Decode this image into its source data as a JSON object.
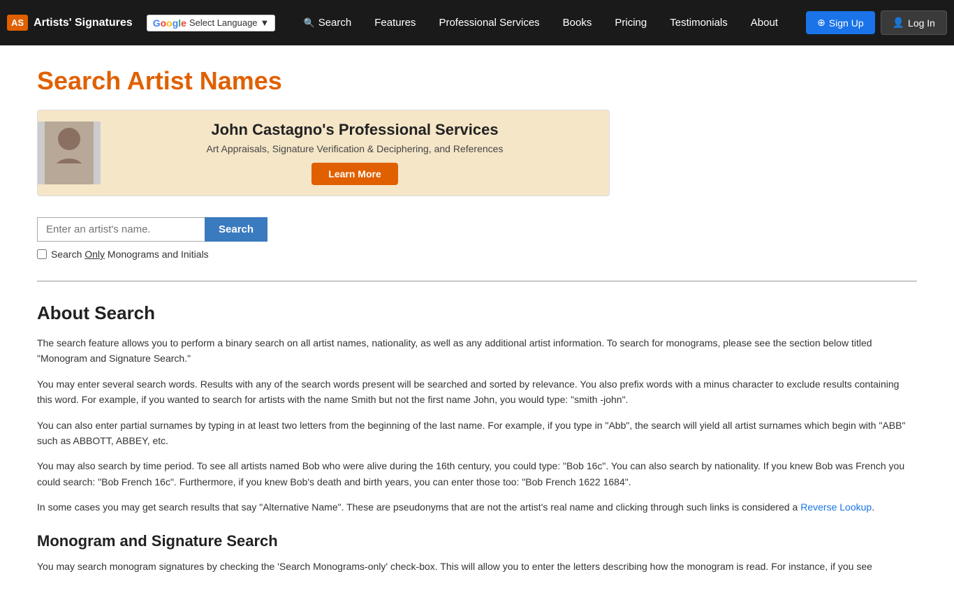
{
  "site": {
    "logo_abbr": "AS",
    "logo_name": "Artists' Signatures"
  },
  "translate": {
    "label": "Select Language",
    "dropdown_icon": "▼"
  },
  "nav": {
    "items": [
      {
        "id": "search",
        "label": "Search",
        "has_icon": true
      },
      {
        "id": "features",
        "label": "Features",
        "has_icon": false
      },
      {
        "id": "professional-services",
        "label": "Professional Services",
        "has_icon": false
      },
      {
        "id": "books",
        "label": "Books",
        "has_icon": false
      },
      {
        "id": "pricing",
        "label": "Pricing",
        "has_icon": false
      },
      {
        "id": "testimonials",
        "label": "Testimonials",
        "has_icon": false
      },
      {
        "id": "about",
        "label": "About",
        "has_icon": false
      }
    ]
  },
  "auth": {
    "signup_label": "Sign Up",
    "login_label": "Log In"
  },
  "page": {
    "title": "Search Artist Names"
  },
  "banner": {
    "title": "John Castagno's Professional Services",
    "subtitle": "Art Appraisals, Signature Verification & Deciphering, and References",
    "btn_label": "Learn More"
  },
  "search": {
    "placeholder": "Enter an artist's name.",
    "btn_label": "Search",
    "monogram_prefix": "Search ",
    "monogram_only": "Only",
    "monogram_suffix": " Monograms and Initials"
  },
  "about_search": {
    "heading": "About Search",
    "para1": "The search feature allows you to perform a binary search on all artist names, nationality, as well as any additional artist information. To search for monograms, please see the section below titled \"Monogram and Signature Search.\"",
    "para2": "You may enter several search words. Results with any of the search words present will be searched and sorted by relevance. You also prefix words with a minus character to exclude results containing this word. For example, if you wanted to search for artists with the name Smith but not the first name John, you would type: \"smith -john\".",
    "para3": "You can also enter partial surnames by typing in at least two letters from the beginning of the last name. For example, if you type in \"Abb\", the search will yield all artist surnames which begin with \"ABB\" such as ABBOTT, ABBEY, etc.",
    "para4": "You may also search by time period. To see all artists named Bob who were alive during the 16th century, you could type: \"Bob 16c\". You can also search by nationality. If you knew Bob was French you could search: \"Bob French 16c\". Furthermore, if you knew Bob's death and birth years, you can enter those too: \"Bob French 1622 1684\".",
    "para5_pre": "In some cases you may get search results that say \"Alternative Name\". These are pseudonyms that are not the artist's real name and clicking through such links is considered a ",
    "para5_link": "Reverse Lookup",
    "para5_post": "."
  },
  "monogram_section": {
    "heading": "Monogram and Signature Search",
    "para1": "You may search monogram signatures by checking the 'Search Monograms-only' check-box. This will allow you to enter the letters describing how the monogram is read. For instance, if you see"
  },
  "colors": {
    "orange": "#e06000",
    "blue_nav": "#1a73e8",
    "dark_bg": "#1a1a1a"
  }
}
